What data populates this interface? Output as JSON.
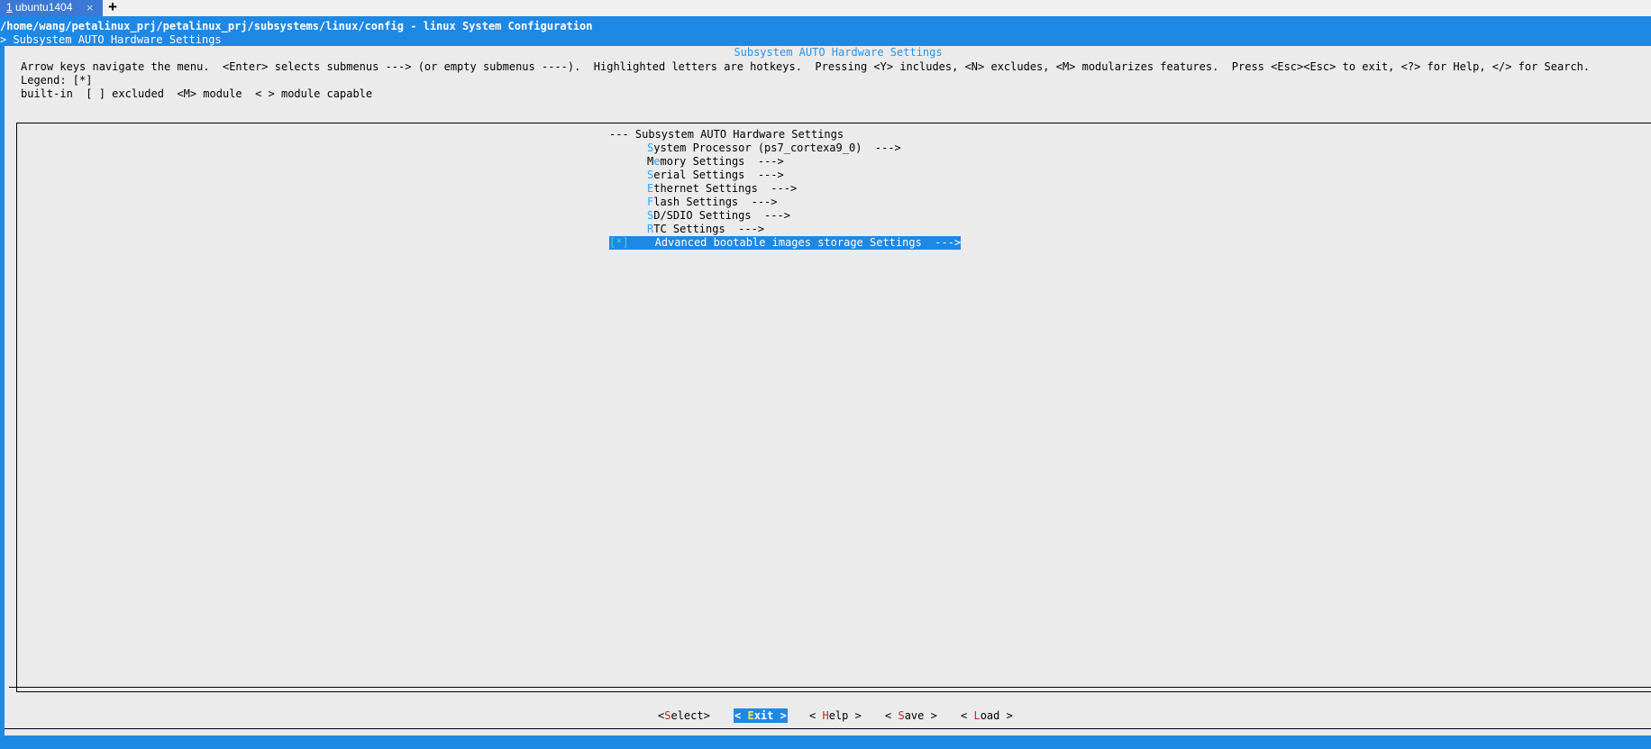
{
  "tab": {
    "number": "1",
    "name": "ubuntu1404",
    "close": "×",
    "new_tab": "+"
  },
  "path_title": "/home/wang/petalinux_prj/petalinux_prj/subsystems/linux/config - linux System Configuration",
  "breadcrumb": "> Subsystem AUTO Hardware Settings",
  "window_title": "Subsystem AUTO Hardware Settings",
  "help_text": "Arrow keys navigate the menu.  <Enter> selects submenus ---> (or empty submenus ----).  Highlighted letters are hotkeys.  Pressing <Y> includes, <N> excludes, <M> modularizes features.  Press <Esc><Esc> to exit, <?> for Help, </> for Search.  Legend: [*]\nbuilt-in  [ ] excluded  <M> module  < > module capable",
  "menu": {
    "header": "--- Subsystem AUTO Hardware Settings",
    "items": [
      {
        "hotkey": "S",
        "rest": "ystem Processor (ps7_cortexa9_0)  --->"
      },
      {
        "prefix": "M",
        "hotkey": "e",
        "rest": "mory Settings  --->"
      },
      {
        "hotkey": "S",
        "rest": "erial Settings  --->"
      },
      {
        "hotkey": "E",
        "rest": "thernet Settings  --->"
      },
      {
        "hotkey": "F",
        "rest": "lash Settings  --->"
      },
      {
        "hotkey": "S",
        "rest": "D/SDIO Settings  --->"
      },
      {
        "hotkey": "R",
        "rest": "TC Settings  --->"
      }
    ],
    "selected": {
      "checkbox": "[*]",
      "label": "Advanced bootable images storage Settings  --->"
    }
  },
  "buttons": {
    "select": {
      "pre": "<",
      "key": "S",
      "post": "elect>"
    },
    "exit": {
      "pre": "< ",
      "key": "E",
      "post": "xit >"
    },
    "help": {
      "pre": "< ",
      "key": "H",
      "post": "elp >"
    },
    "save": {
      "pre": "< ",
      "key": "S",
      "post": "ave >"
    },
    "load": {
      "pre": "< ",
      "key": "L",
      "post": "oad >"
    }
  }
}
